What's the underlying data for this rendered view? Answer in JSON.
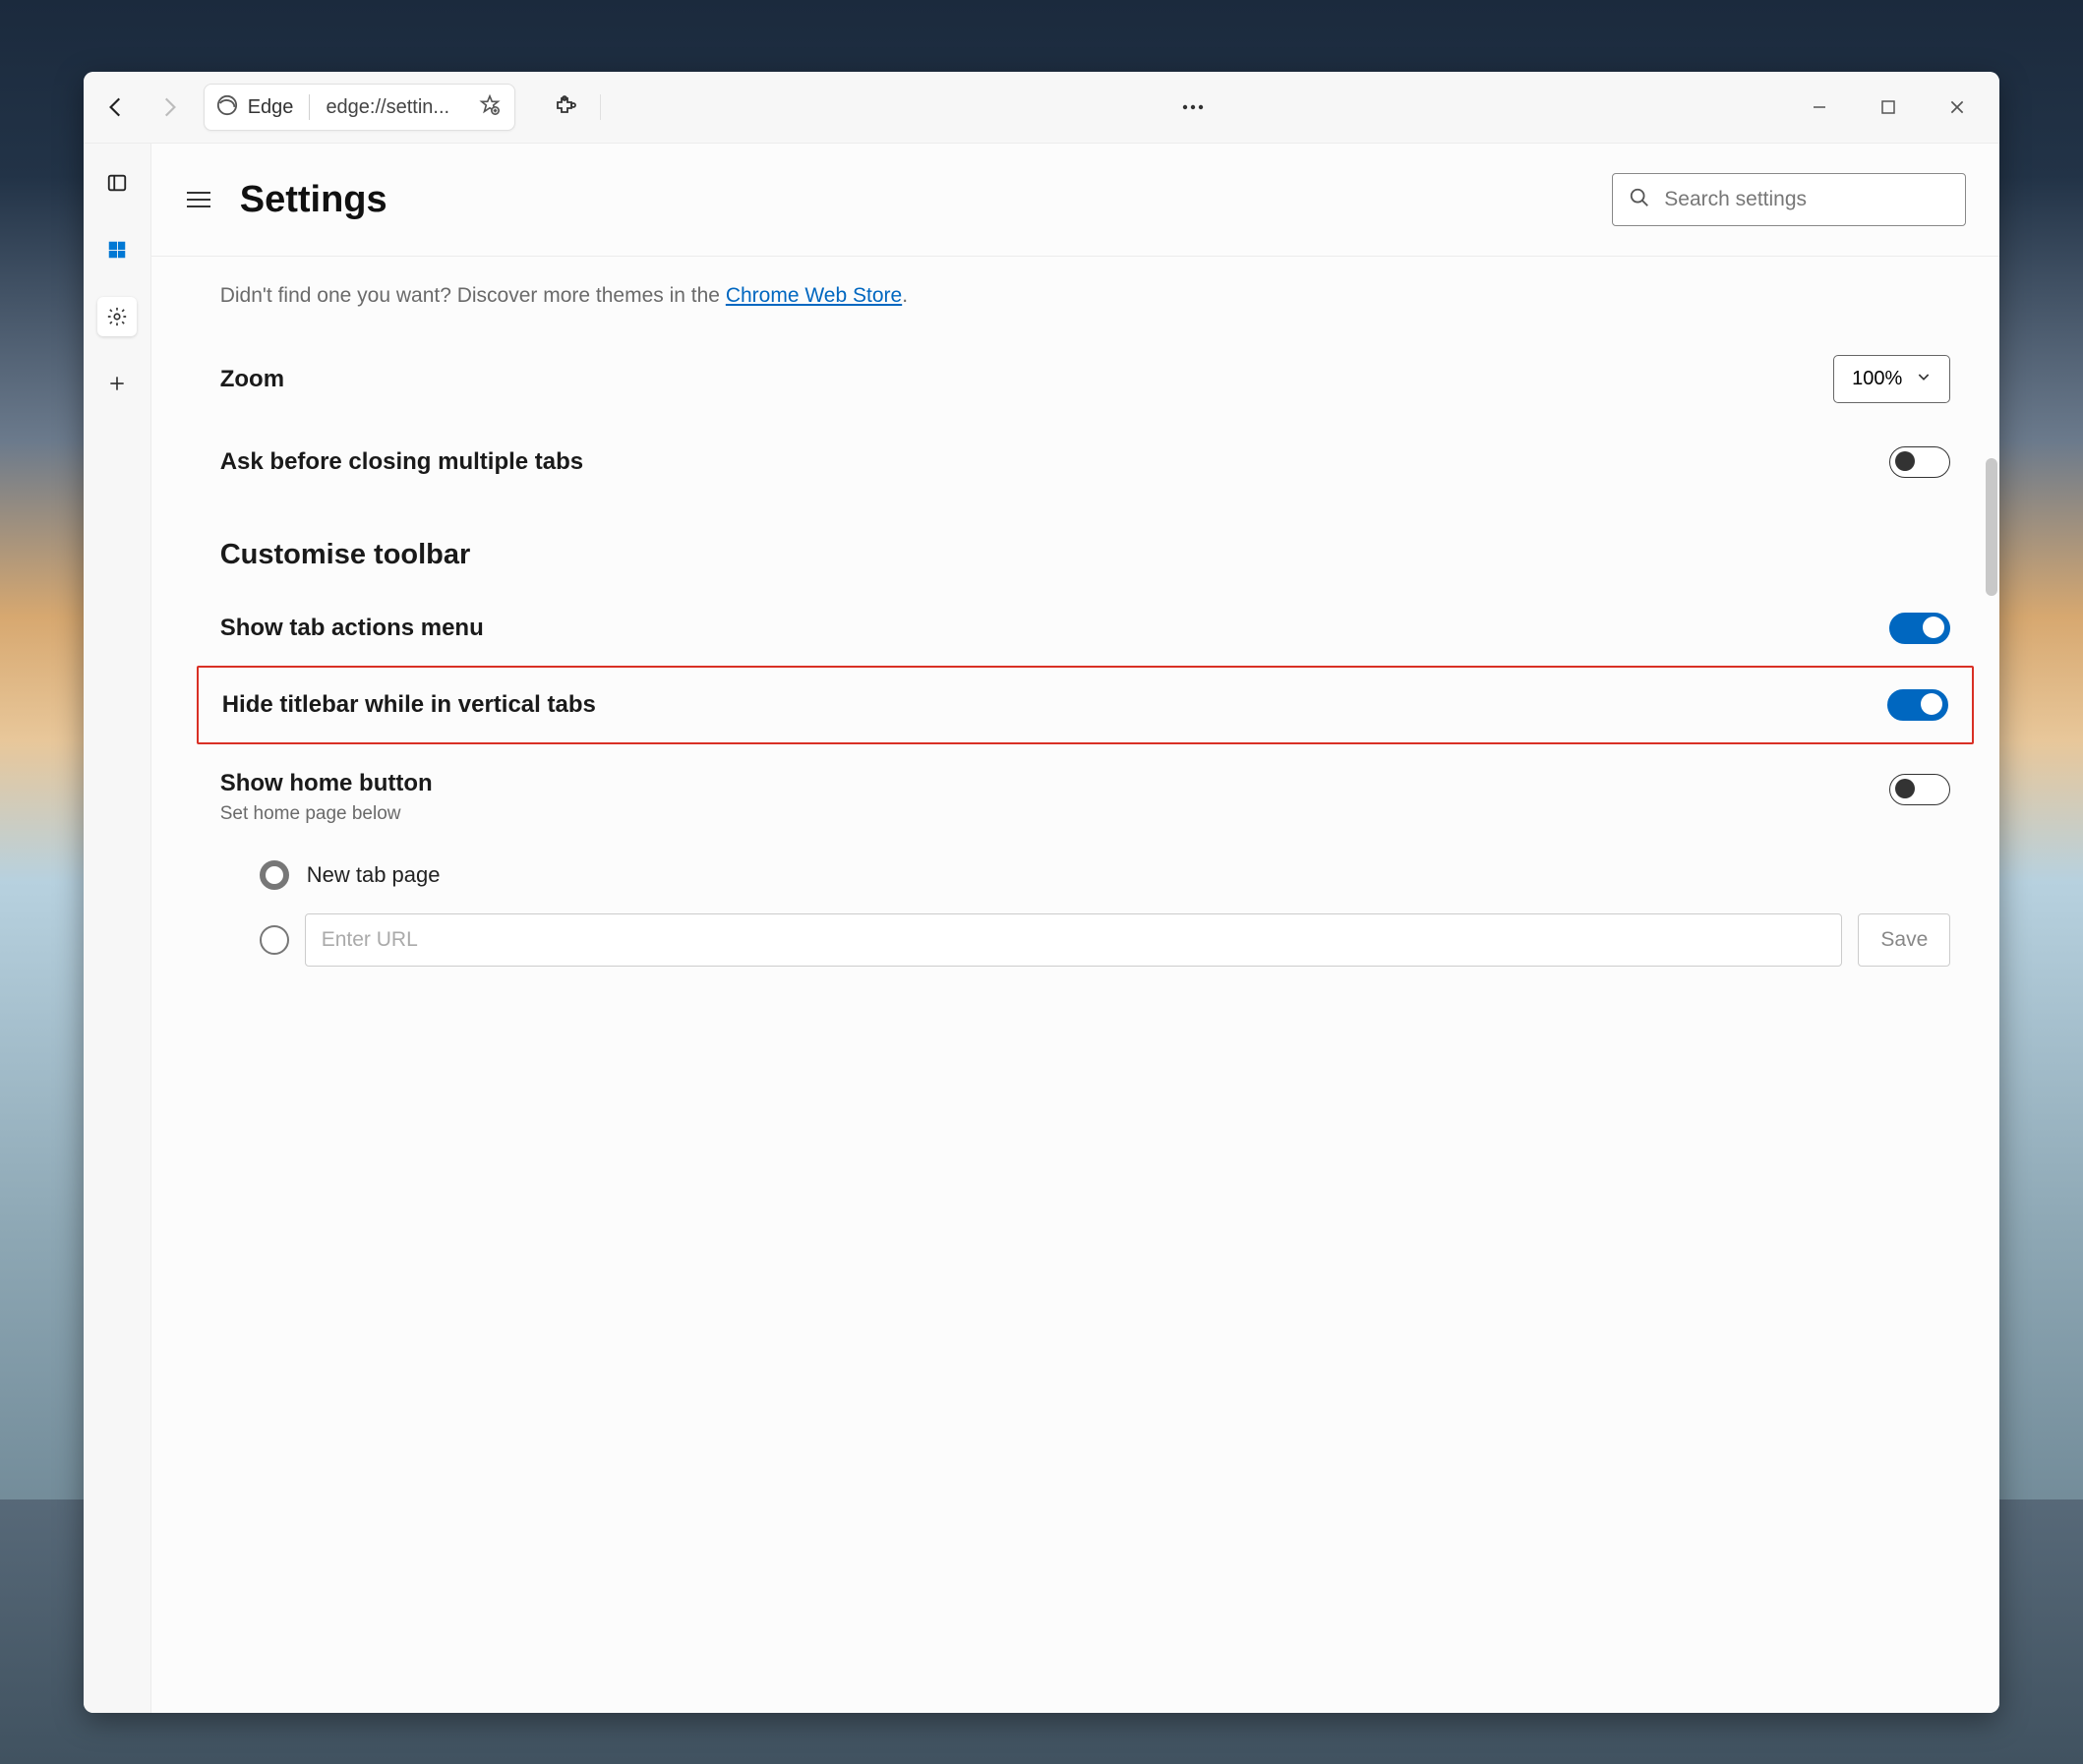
{
  "tab": {
    "name": "Edge",
    "url_display": "edge://settin..."
  },
  "page_title": "Settings",
  "search_placeholder": "Search settings",
  "hint_prefix": "Didn't find one you want? Discover more themes in the ",
  "hint_link": "Chrome Web Store",
  "hint_suffix": ".",
  "zoom": {
    "label": "Zoom",
    "value": "100%"
  },
  "ask_close_label": "Ask before closing multiple tabs",
  "section_title": "Customise toolbar",
  "show_tab_actions_label": "Show tab actions menu",
  "hide_titlebar_label": "Hide titlebar while in vertical tabs",
  "home_button": {
    "label": "Show home button",
    "sub": "Set home page below"
  },
  "radio_new_tab": "New tab page",
  "url_placeholder": "Enter URL",
  "save_label": "Save"
}
